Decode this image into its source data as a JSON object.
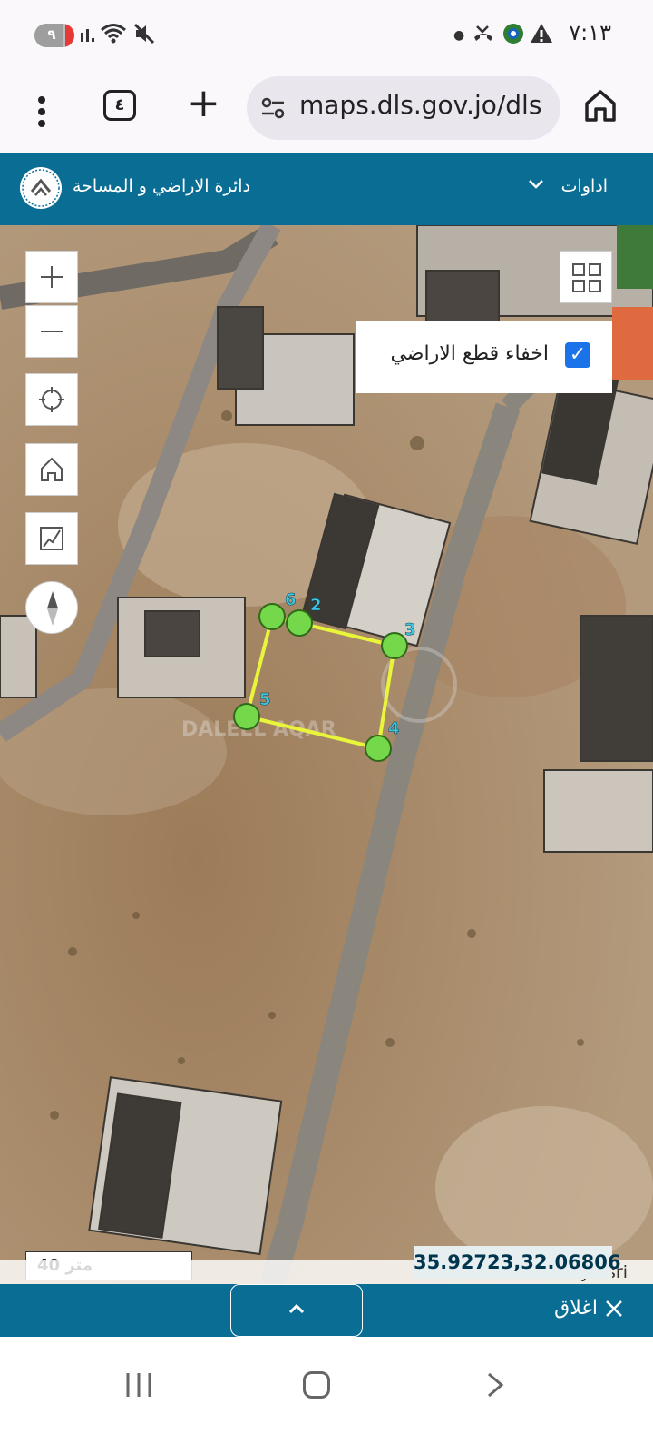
{
  "status_bar": {
    "notification_count": "٩",
    "time": "٧:١٣",
    "icons": [
      "signal-icon",
      "wifi-icon",
      "mute-icon",
      "dot-icon",
      "missed-call-icon",
      "vpn-icon",
      "warning-icon"
    ]
  },
  "browser": {
    "url": "maps.dls.gov.jo/dls",
    "tabs_count": "٤",
    "icons": [
      "menu-icon",
      "tabs-icon",
      "new-tab-icon",
      "site-settings-icon",
      "home-icon"
    ]
  },
  "header": {
    "title": "دائرة الاراضي و المساحة",
    "tools_label": "اداوات"
  },
  "map": {
    "layer_toggle": {
      "label": "اخفاء قطع الاراضي",
      "checked": true
    },
    "controls": [
      "zoom-in-icon",
      "zoom-out-icon",
      "locate-icon",
      "home-icon",
      "measure-icon",
      "compass-icon",
      "layers-icon"
    ],
    "parcel_vertices": [
      "6",
      "2",
      "3",
      "4",
      "5"
    ],
    "watermark": "DALEEL AQAR",
    "scale_label": "40 متر",
    "coordinates": "35.92723,32.06806",
    "attribution": "Powered by Esri",
    "colors": {
      "parcel_line": "#e8f53a",
      "vertex_fill": "#74d84a",
      "vertex_label": "#3ec7e0"
    }
  },
  "bottom_bar": {
    "close_label": "اغلاق",
    "icons": [
      "chevron-up-icon",
      "close-icon"
    ]
  },
  "nav_bar": {
    "icons": [
      "recent-apps-icon",
      "home-icon",
      "back-icon"
    ]
  },
  "colors": {
    "primary": "#0a6d93",
    "checkbox": "#1a73e8"
  }
}
